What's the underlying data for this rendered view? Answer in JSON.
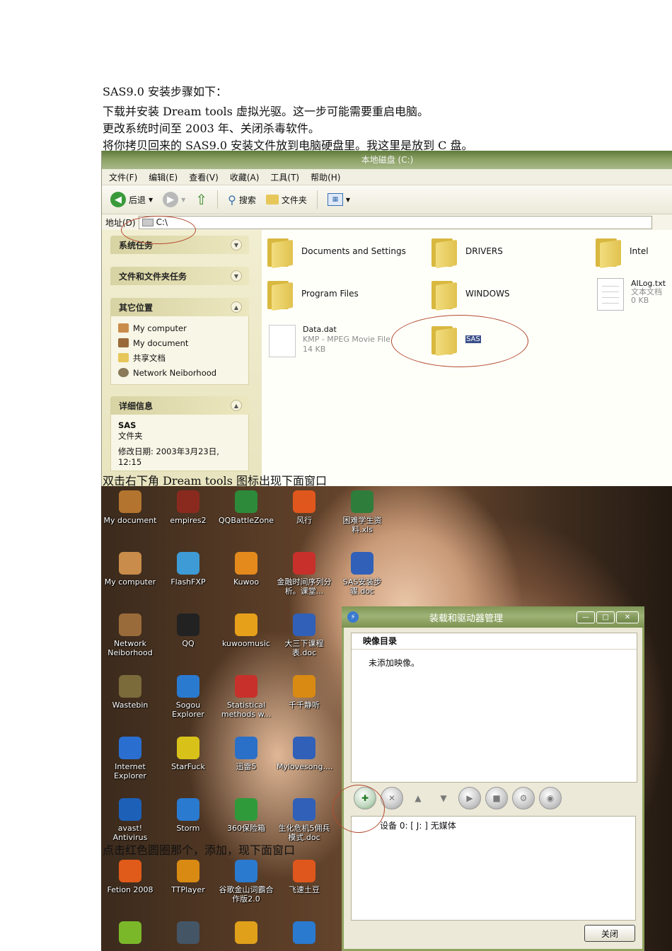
{
  "doc": {
    "lines": [
      "SAS9.0 安装步骤如下：",
      "下载并安装 Dream tools 虚拟光驱。这一步可能需要重启电脑。",
      "更改系统时间至 2003 年、关闭杀毒软件。",
      "将你拷贝回来的 SAS9.0 安装文件放到电脑硬盘里。我这里是放到 C 盘。"
    ],
    "caption_dream_tools": "双击右下角 Dream tools  图标出现下面窗口",
    "caption_add": "点击红色圆圈那个，添加，现下面窗口"
  },
  "explorer": {
    "title": "本地磁盘 (C:)",
    "menu": [
      "文件(F)",
      "编辑(E)",
      "查看(V)",
      "收藏(A)",
      "工具(T)",
      "帮助(H)"
    ],
    "toolbar": {
      "back": "后退",
      "search": "搜索",
      "folders": "文件夹"
    },
    "address_label": "地址(D)",
    "address_value": "C:\\",
    "panels": {
      "system_tasks": "系统任务",
      "file_tasks": "文件和文件夹任务",
      "other_places": "其它位置",
      "details": "详细信息"
    },
    "places": [
      "My computer",
      "My document",
      "共享文档",
      "Network Neiborhood"
    ],
    "details": {
      "name": "SAS",
      "type": "文件夹",
      "modified": "修改日期: 2003年3月23日,",
      "time": "12:15"
    },
    "items": [
      {
        "name": "Documents and Settings"
      },
      {
        "name": "DRIVERS"
      },
      {
        "name": "Intel"
      },
      {
        "name": "Program Files"
      },
      {
        "name": "WINDOWS"
      },
      {
        "name": "AILog.txt",
        "type": "文本文档",
        "size": "0 KB"
      },
      {
        "name": "Data.dat",
        "type": "KMP - MPEG Movie File",
        "size": "14 KB"
      },
      {
        "name": "SAS"
      }
    ]
  },
  "desktop": {
    "icons": [
      {
        "label": "My document",
        "color": "#b3742f"
      },
      {
        "label": "empires2",
        "color": "#8a2a1e"
      },
      {
        "label": "QQBattleZone",
        "color": "#2c8a3a"
      },
      {
        "label": "风行",
        "color": "#e0571d"
      },
      {
        "label": "困难学生资料.xls",
        "color": "#2f7d3a"
      },
      {
        "label": "My computer",
        "color": "#c98c4a"
      },
      {
        "label": "FlashFXP",
        "color": "#3e9bd6"
      },
      {
        "label": "Kuwoo",
        "color": "#e48a1c"
      },
      {
        "label": "金融时间序列分析。课堂...",
        "color": "#c8302b"
      },
      {
        "label": "SAS安装步骤.doc",
        "color": "#3060b8"
      },
      {
        "label": "Network Neiborhood",
        "color": "#9a6b3a"
      },
      {
        "label": "QQ",
        "color": "#222222"
      },
      {
        "label": "kuwoomusic",
        "color": "#e6a01a"
      },
      {
        "label": "大三下课程表.doc",
        "color": "#3060b8"
      },
      {
        "label": "Wastebin",
        "color": "#7b6a3a"
      },
      {
        "label": "Sogou Explorer",
        "color": "#2a7ad0"
      },
      {
        "label": "Statistical methods w...",
        "color": "#c8302b"
      },
      {
        "label": "千千静听",
        "color": "#d88a12"
      },
      {
        "label": "Internet Explorer",
        "color": "#2a6fd0"
      },
      {
        "label": "StarFuck",
        "color": "#d8c21a"
      },
      {
        "label": "迅雷5",
        "color": "#2a70c8"
      },
      {
        "label": "Mylovesong....",
        "color": "#3060b8"
      },
      {
        "label": "avast! Antivirus",
        "color": "#1d60b8"
      },
      {
        "label": "Storm",
        "color": "#2a7ad0"
      },
      {
        "label": "360保险箱",
        "color": "#2f9a3a"
      },
      {
        "label": "生化危机5佣兵模式.doc",
        "color": "#3060b8"
      },
      {
        "label": "Fetion 2008",
        "color": "#e05a1a"
      },
      {
        "label": "TTPlayer",
        "color": "#d88a12"
      },
      {
        "label": "谷歌金山词霸合作版2.0",
        "color": "#2a7ad0"
      },
      {
        "label": "飞速土豆",
        "color": "#e0571d"
      },
      {
        "label": "",
        "color": "#7ab82a"
      },
      {
        "label": "",
        "color": "#445566"
      },
      {
        "label": "",
        "color": "#e0a01a"
      },
      {
        "label": "",
        "color": "#2a7ad0"
      }
    ]
  },
  "dialog": {
    "title": "装载和驱动器管理",
    "images_header": "映像目录",
    "images_empty": "未添加映像。",
    "device": "设备 0: [ J: ] 无媒体",
    "close": "关闭"
  }
}
